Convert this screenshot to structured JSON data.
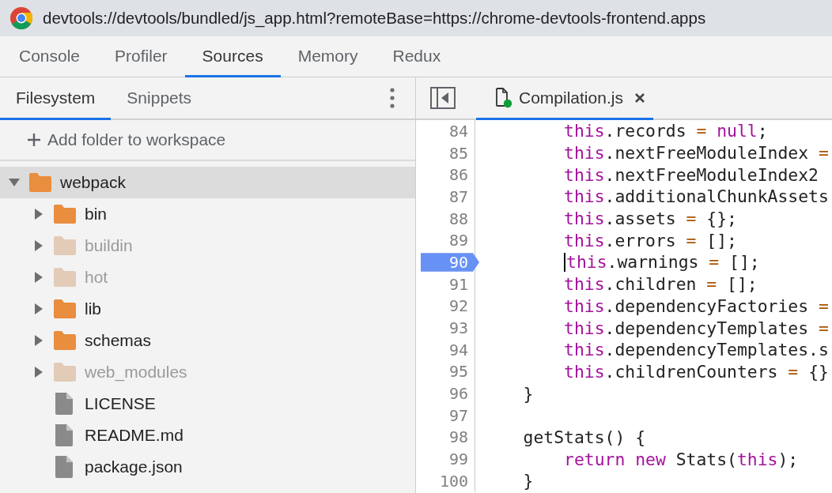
{
  "title_bar": {
    "url": "devtools://devtools/bundled/js_app.html?remoteBase=https://chrome-devtools-frontend.apps"
  },
  "main_tabs": [
    {
      "label": "Console",
      "selected": false
    },
    {
      "label": "Profiler",
      "selected": false
    },
    {
      "label": "Sources",
      "selected": true
    },
    {
      "label": "Memory",
      "selected": false
    },
    {
      "label": "Redux",
      "selected": false
    }
  ],
  "navigator": {
    "tabs": [
      {
        "label": "Filesystem",
        "selected": true
      },
      {
        "label": "Snippets",
        "selected": false
      }
    ],
    "add_folder": {
      "label": "Add folder to workspace"
    },
    "tree": [
      {
        "label": "webpack",
        "kind": "folder",
        "expanded": true,
        "selected": true,
        "dimmed": false,
        "children": [
          {
            "label": "bin",
            "kind": "folder",
            "expanded": false,
            "selected": false,
            "dimmed": false
          },
          {
            "label": "buildin",
            "kind": "folder",
            "expanded": false,
            "selected": false,
            "dimmed": true
          },
          {
            "label": "hot",
            "kind": "folder",
            "expanded": false,
            "selected": false,
            "dimmed": true
          },
          {
            "label": "lib",
            "kind": "folder",
            "expanded": false,
            "selected": false,
            "dimmed": false
          },
          {
            "label": "schemas",
            "kind": "folder",
            "expanded": false,
            "selected": false,
            "dimmed": false
          },
          {
            "label": "web_modules",
            "kind": "folder",
            "expanded": false,
            "selected": false,
            "dimmed": true
          },
          {
            "label": "LICENSE",
            "kind": "file",
            "selected": false,
            "dimmed": false
          },
          {
            "label": "README.md",
            "kind": "file",
            "selected": false,
            "dimmed": false
          },
          {
            "label": "package.json",
            "kind": "file",
            "selected": false,
            "dimmed": false
          }
        ]
      }
    ]
  },
  "editor": {
    "tabs": [
      {
        "label": "Compilation.js",
        "selected": true
      }
    ],
    "lines": [
      {
        "number": "84",
        "breakpoint": false,
        "caret": false,
        "tokens": [
          {
            "kind": "keyword",
            "text": "        this"
          },
          {
            "kind": "plain",
            "text": ".records "
          },
          {
            "kind": "operator",
            "text": "="
          },
          {
            "kind": "keyword",
            "text": " null"
          },
          {
            "kind": "plain",
            "text": ";"
          }
        ]
      },
      {
        "number": "85",
        "breakpoint": false,
        "caret": false,
        "tokens": [
          {
            "kind": "keyword",
            "text": "        this"
          },
          {
            "kind": "plain",
            "text": ".nextFreeModuleIndex "
          },
          {
            "kind": "operator",
            "text": "="
          }
        ]
      },
      {
        "number": "86",
        "breakpoint": false,
        "caret": false,
        "tokens": [
          {
            "kind": "keyword",
            "text": "        this"
          },
          {
            "kind": "plain",
            "text": ".nextFreeModuleIndex2"
          }
        ]
      },
      {
        "number": "87",
        "breakpoint": false,
        "caret": false,
        "tokens": [
          {
            "kind": "keyword",
            "text": "        this"
          },
          {
            "kind": "plain",
            "text": ".additionalChunkAssets"
          }
        ]
      },
      {
        "number": "88",
        "breakpoint": false,
        "caret": false,
        "tokens": [
          {
            "kind": "keyword",
            "text": "        this"
          },
          {
            "kind": "plain",
            "text": ".assets "
          },
          {
            "kind": "operator",
            "text": "="
          },
          {
            "kind": "plain",
            "text": " {};"
          }
        ]
      },
      {
        "number": "89",
        "breakpoint": false,
        "caret": false,
        "tokens": [
          {
            "kind": "keyword",
            "text": "        this"
          },
          {
            "kind": "plain",
            "text": ".errors "
          },
          {
            "kind": "operator",
            "text": "="
          },
          {
            "kind": "plain",
            "text": " [];"
          }
        ]
      },
      {
        "number": "90",
        "breakpoint": true,
        "caret": true,
        "tokens": [
          {
            "kind": "keyword",
            "text": "this"
          },
          {
            "kind": "plain",
            "text": ".warnings "
          },
          {
            "kind": "operator",
            "text": "="
          },
          {
            "kind": "plain",
            "text": " [];"
          }
        ]
      },
      {
        "number": "91",
        "breakpoint": false,
        "caret": false,
        "tokens": [
          {
            "kind": "keyword",
            "text": "        this"
          },
          {
            "kind": "plain",
            "text": ".children "
          },
          {
            "kind": "operator",
            "text": "="
          },
          {
            "kind": "plain",
            "text": " [];"
          }
        ]
      },
      {
        "number": "92",
        "breakpoint": false,
        "caret": false,
        "tokens": [
          {
            "kind": "keyword",
            "text": "        this"
          },
          {
            "kind": "plain",
            "text": ".dependencyFactories "
          },
          {
            "kind": "operator",
            "text": "="
          }
        ]
      },
      {
        "number": "93",
        "breakpoint": false,
        "caret": false,
        "tokens": [
          {
            "kind": "keyword",
            "text": "        this"
          },
          {
            "kind": "plain",
            "text": ".dependencyTemplates "
          },
          {
            "kind": "operator",
            "text": "="
          }
        ]
      },
      {
        "number": "94",
        "breakpoint": false,
        "caret": false,
        "tokens": [
          {
            "kind": "keyword",
            "text": "        this"
          },
          {
            "kind": "plain",
            "text": ".dependencyTemplates.s"
          }
        ]
      },
      {
        "number": "95",
        "breakpoint": false,
        "caret": false,
        "tokens": [
          {
            "kind": "keyword",
            "text": "        this"
          },
          {
            "kind": "plain",
            "text": ".childrenCounters "
          },
          {
            "kind": "operator",
            "text": "="
          },
          {
            "kind": "plain",
            "text": " {}"
          }
        ]
      },
      {
        "number": "96",
        "breakpoint": false,
        "caret": false,
        "tokens": [
          {
            "kind": "plain",
            "text": "    }"
          }
        ]
      },
      {
        "number": "97",
        "breakpoint": false,
        "caret": false
      },
      {
        "number": "98",
        "breakpoint": false,
        "caret": false,
        "tokens": [
          {
            "kind": "plain",
            "text": "    getStats() {"
          }
        ]
      },
      {
        "number": "99",
        "breakpoint": false,
        "caret": false,
        "tokens": [
          {
            "kind": "keyword",
            "text": "        return"
          },
          {
            "kind": "keyword",
            "text": " new"
          },
          {
            "kind": "plain",
            "text": " Stats("
          },
          {
            "kind": "keyword",
            "text": "this"
          },
          {
            "kind": "plain",
            "text": ");"
          }
        ]
      },
      {
        "number": "100",
        "breakpoint": false,
        "caret": false,
        "tokens": [
          {
            "kind": "plain",
            "text": "    }"
          }
        ]
      }
    ]
  }
}
